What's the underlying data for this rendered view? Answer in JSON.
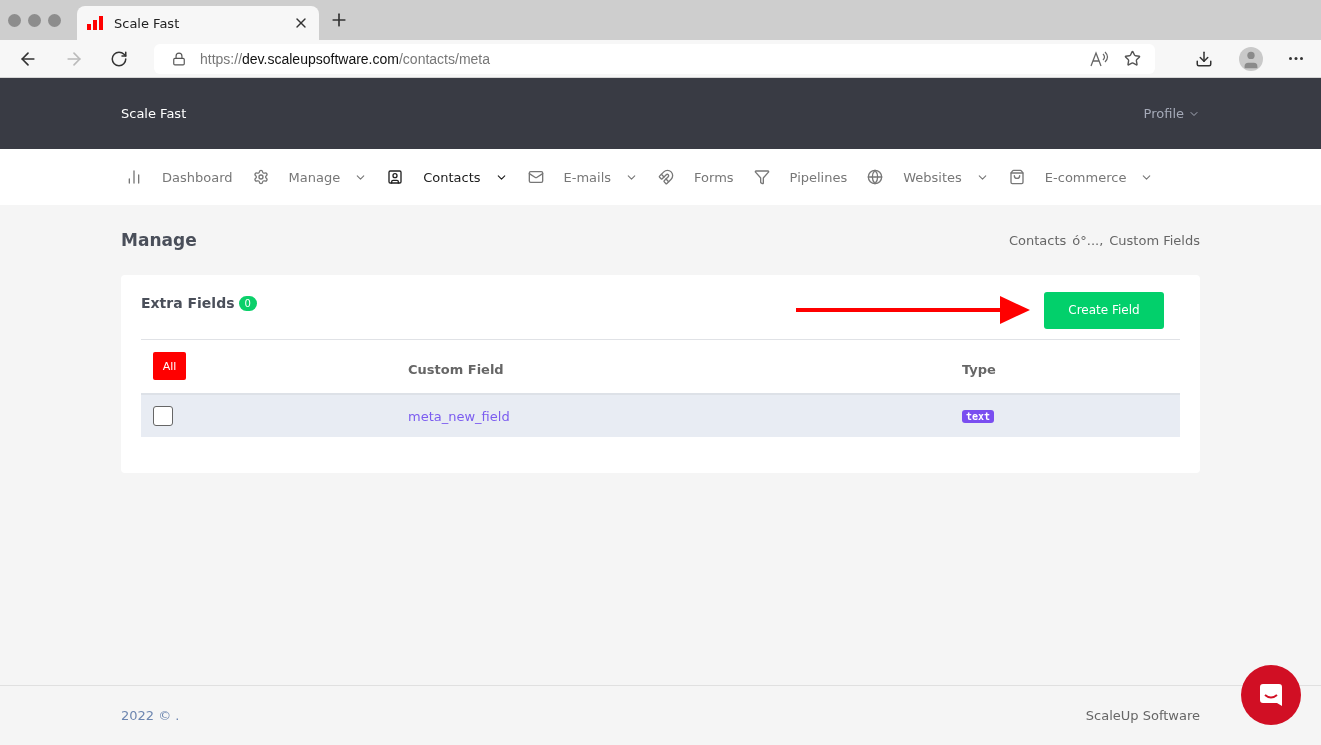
{
  "browser": {
    "tab_title": "Scale Fast",
    "url": {
      "scheme": "https://",
      "host": "dev.scaleupsoftware.com",
      "path": "/contacts/meta"
    }
  },
  "header": {
    "brand": "Scale Fast",
    "profile": "Profile"
  },
  "nav": [
    {
      "label": "Dashboard",
      "dropdown": false,
      "selected": false
    },
    {
      "label": "Manage",
      "dropdown": true,
      "selected": false
    },
    {
      "label": "Contacts",
      "dropdown": true,
      "selected": true
    },
    {
      "label": "E-mails",
      "dropdown": true,
      "selected": false
    },
    {
      "label": "Forms",
      "dropdown": false,
      "selected": false
    },
    {
      "label": "Pipelines",
      "dropdown": false,
      "selected": false
    },
    {
      "label": "Websites",
      "dropdown": true,
      "selected": false
    },
    {
      "label": "E-commerce",
      "dropdown": true,
      "selected": false
    }
  ],
  "page": {
    "title": "Manage",
    "breadcrumb": [
      "Contacts",
      "ó°...,",
      "Custom Fields"
    ]
  },
  "card": {
    "title": "Extra Fields",
    "count": "0",
    "create_button": "Create Field",
    "table": {
      "select_all": "All",
      "columns": [
        "Custom Field",
        "Type"
      ],
      "rows": [
        {
          "checked": false,
          "name": "meta_new_field",
          "type": "text"
        }
      ]
    }
  },
  "footer": {
    "copyright": "2022 © .",
    "company": "ScaleUp Software"
  }
}
